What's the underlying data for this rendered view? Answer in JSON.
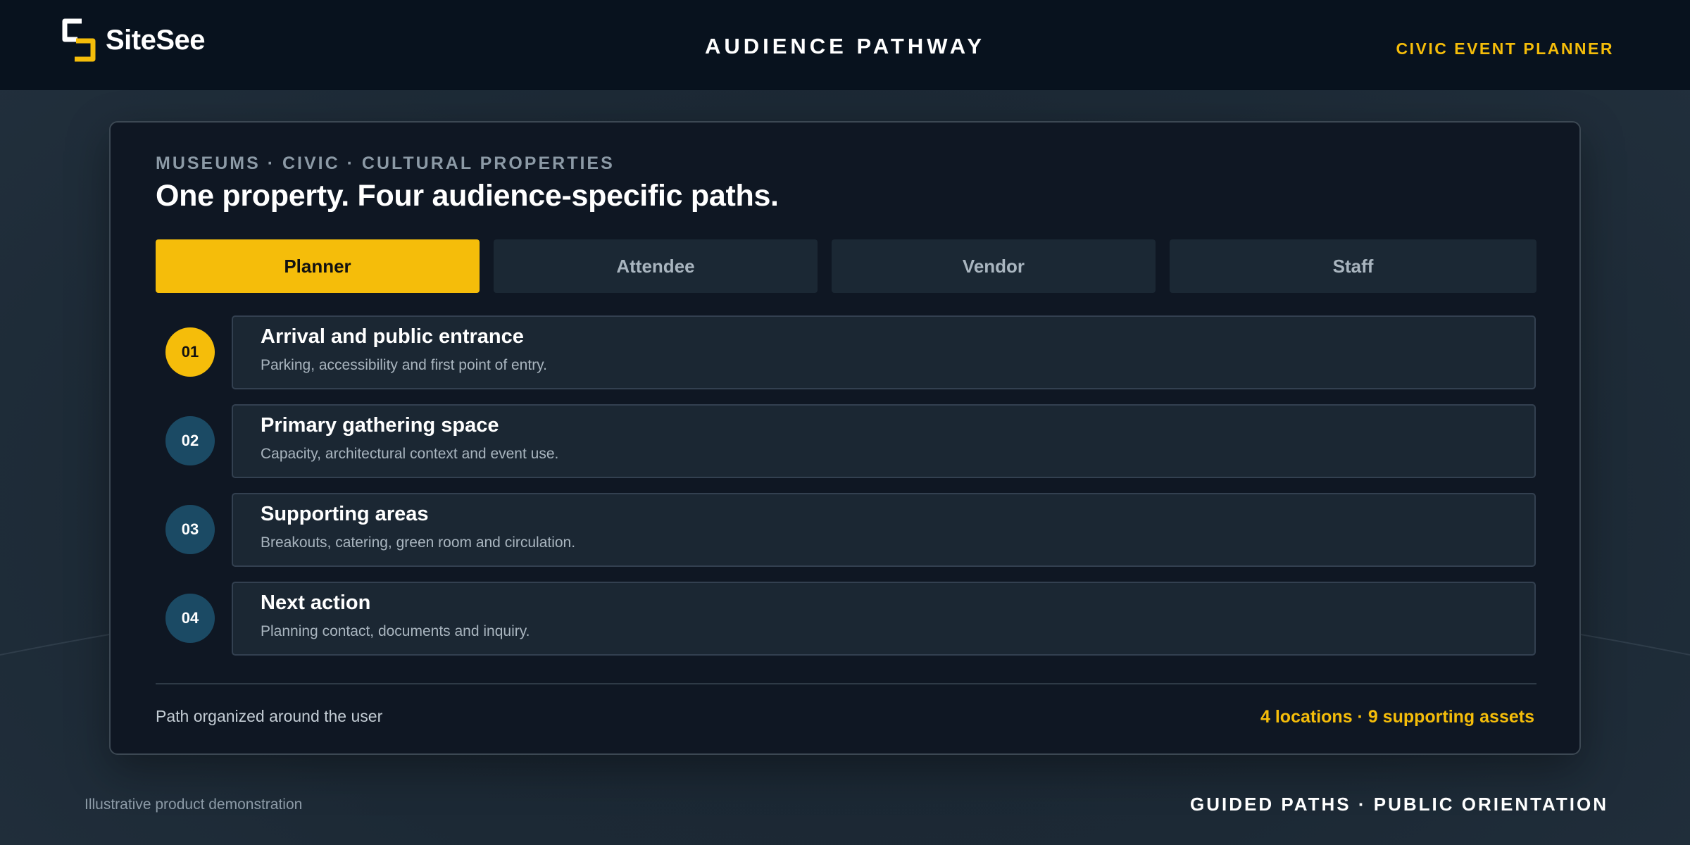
{
  "brand": {
    "name": "SiteSee",
    "colors": {
      "accent": "#f5bd0a",
      "header_bg": "#08121e",
      "card_bg": "#0f1723",
      "step_badge": "#1b4a64"
    }
  },
  "header": {
    "title": "AUDIENCE PATHWAY",
    "right_label": "CIVIC EVENT PLANNER"
  },
  "card": {
    "eyebrow": "MUSEUMS · CIVIC · CULTURAL PROPERTIES",
    "headline": "One property. Four audience-specific paths.",
    "tabs": [
      {
        "label": "Planner",
        "active": true
      },
      {
        "label": "Attendee",
        "active": false
      },
      {
        "label": "Vendor",
        "active": false
      },
      {
        "label": "Staff",
        "active": false
      }
    ],
    "steps": [
      {
        "number": "01",
        "title": "Arrival and public entrance",
        "description": "Parking, accessibility and first point of entry.",
        "active": true
      },
      {
        "number": "02",
        "title": "Primary gathering space",
        "description": "Capacity, architectural context and event use.",
        "active": false
      },
      {
        "number": "03",
        "title": "Supporting areas",
        "description": "Breakouts, catering, green room and circulation.",
        "active": false
      },
      {
        "number": "04",
        "title": "Next action",
        "description": "Planning contact, documents and inquiry.",
        "active": false
      }
    ],
    "footer_left": "Path organized around the user",
    "footer_right": "4 locations · 9 supporting assets"
  },
  "page_footer": {
    "note": "Illustrative product demonstration",
    "tagline": "GUIDED PATHS · PUBLIC ORIENTATION"
  }
}
